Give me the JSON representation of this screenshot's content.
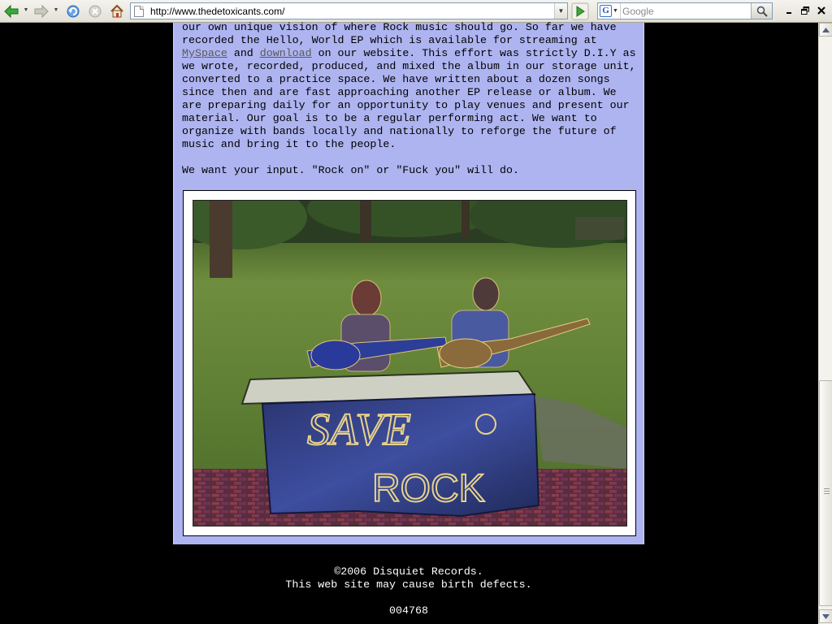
{
  "browser": {
    "url": "http://www.thedetoxicants.com/",
    "search_placeholder": "Google",
    "search_engine_letter": "G",
    "icons": [
      "back-icon",
      "forward-icon",
      "reload-icon",
      "stop-icon",
      "home-icon",
      "go-icon",
      "search-icon",
      "minimize-icon",
      "restore-icon",
      "close-icon"
    ]
  },
  "page": {
    "paragraph": {
      "lines": [
        "our own unique vision of where Rock music should go. So far we have",
        "recorded the Hello, World EP which is available for streaming at"
      ],
      "link_myspace": "MySpace",
      "text_and": " and ",
      "link_download": "download",
      "text_after_links": " on our website. This effort was strictly D.I.Y as",
      "rest_lines": [
        "we wrote, recorded, produced, and mixed the album in our storage unit,",
        "converted to a practice space. We have written about a dozen songs",
        "since then and are fast approaching another EP release or album. We",
        "are preparing daily for an opportunity to play venues and present our",
        "material. Our goal is to be a regular performing act. We want to",
        "organize with bands locally and nationally to reforge the future of",
        "music and bring it to the people."
      ]
    },
    "input_line": "We want your input. \"Rock on\" or \"Fuck you\" will do.",
    "photo": {
      "sign_line_1": "SAVE",
      "sign_line_2": "ROCK"
    }
  },
  "footer": {
    "copyright": "©2006 Disquiet Records.",
    "disclaimer": "This web site may cause birth defects.",
    "counter": "004768"
  },
  "colors": {
    "page_background": "#000000",
    "content_background": "#aeb4f0",
    "link": "#5a5a5a",
    "footer_text": "#ffffff"
  }
}
